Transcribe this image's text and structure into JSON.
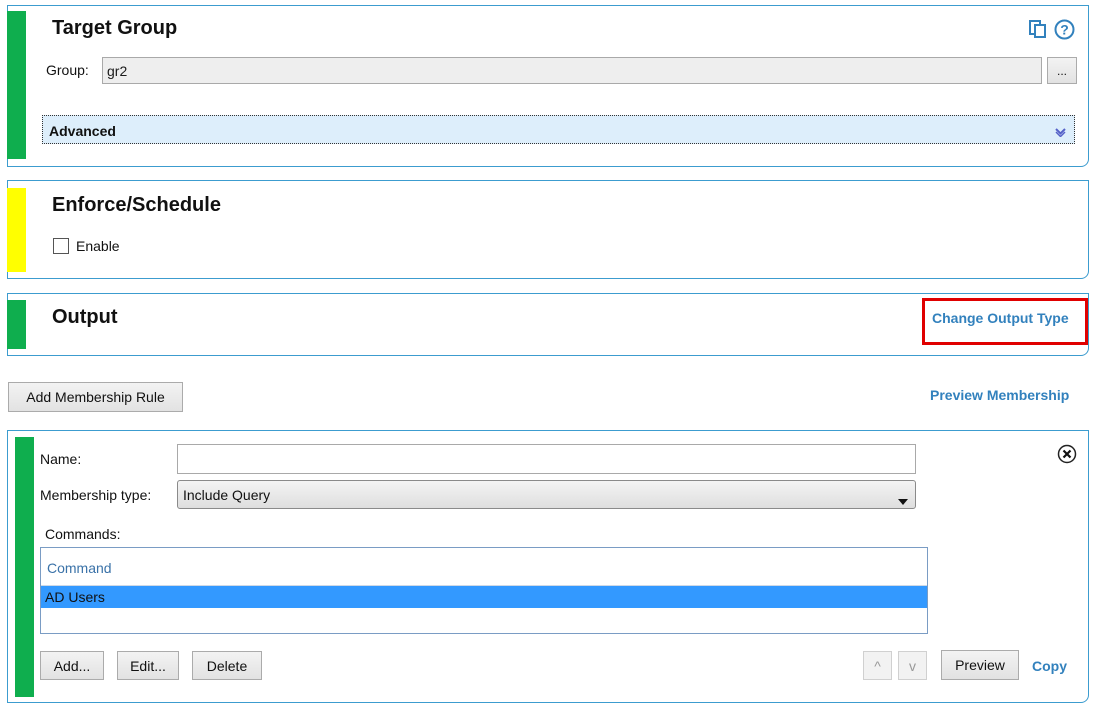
{
  "target_group": {
    "title": "Target Group",
    "group_label": "Group:",
    "group_value": "gr2",
    "browse_label": "...",
    "advanced_label": "Advanced"
  },
  "enforce": {
    "title": "Enforce/Schedule",
    "enable_label": "Enable",
    "enable_checked": false
  },
  "output": {
    "title": "Output",
    "change_output_type": "Change Output Type"
  },
  "membership": {
    "add_rule_label": "Add Membership Rule",
    "preview_membership": "Preview Membership"
  },
  "rule": {
    "name_label": "Name:",
    "name_value": "",
    "type_label": "Membership type:",
    "type_value": "Include Query",
    "commands_label": "Commands:",
    "table_header": "Command",
    "rows": [
      "AD Users"
    ],
    "add_label": "Add...",
    "edit_label": "Edit...",
    "delete_label": "Delete",
    "up_label": "^",
    "down_label": "v",
    "preview_label": "Preview",
    "copy_label": "Copy"
  },
  "colors": {
    "stripe_green": "#0fae4e",
    "stripe_yellow": "#ffff00",
    "panel_border": "#3c9ccf",
    "link": "#3281bd",
    "selection": "#3399ff",
    "highlight_box": "#e00000"
  }
}
